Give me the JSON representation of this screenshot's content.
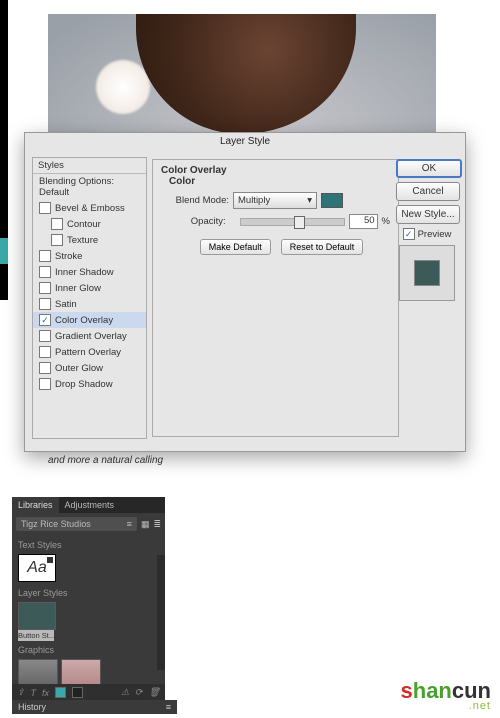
{
  "dialog": {
    "title": "Layer Style",
    "styles_header": "Styles",
    "blending_default": "Blending Options: Default",
    "items": [
      {
        "label": "Bevel & Emboss",
        "checked": false,
        "indent": false
      },
      {
        "label": "Contour",
        "checked": false,
        "indent": true
      },
      {
        "label": "Texture",
        "checked": false,
        "indent": true
      },
      {
        "label": "Stroke",
        "checked": false,
        "indent": false
      },
      {
        "label": "Inner Shadow",
        "checked": false,
        "indent": false
      },
      {
        "label": "Inner Glow",
        "checked": false,
        "indent": false
      },
      {
        "label": "Satin",
        "checked": false,
        "indent": false
      },
      {
        "label": "Color Overlay",
        "checked": true,
        "indent": false,
        "selected": true
      },
      {
        "label": "Gradient Overlay",
        "checked": false,
        "indent": false
      },
      {
        "label": "Pattern Overlay",
        "checked": false,
        "indent": false
      },
      {
        "label": "Outer Glow",
        "checked": false,
        "indent": false
      },
      {
        "label": "Drop Shadow",
        "checked": false,
        "indent": false
      }
    ],
    "center": {
      "title": "Color Overlay",
      "subtitle": "Color",
      "blend_label": "Blend Mode:",
      "blend_value": "Multiply",
      "opacity_label": "Opacity:",
      "opacity_value": "50",
      "opacity_unit": "%",
      "make_default": "Make Default",
      "reset_default": "Reset to Default",
      "swatch_color": "#2e7376"
    },
    "buttons": {
      "ok": "OK",
      "cancel": "Cancel",
      "new_style": "New Style...",
      "preview": "Preview"
    }
  },
  "caption": "and more a natural calling",
  "panel2": {
    "tabs": {
      "libraries": "Libraries",
      "adjustments": "Adjustments"
    },
    "library_name": "Tigz Rice Studios",
    "sections": {
      "text_styles": "Text Styles",
      "layer_styles": "Layer Styles",
      "graphics": "Graphics"
    },
    "aa": "Aa",
    "layer_style_label": "Button St...",
    "history": "History"
  },
  "logo": {
    "text": "shancun",
    "net": ".net"
  }
}
